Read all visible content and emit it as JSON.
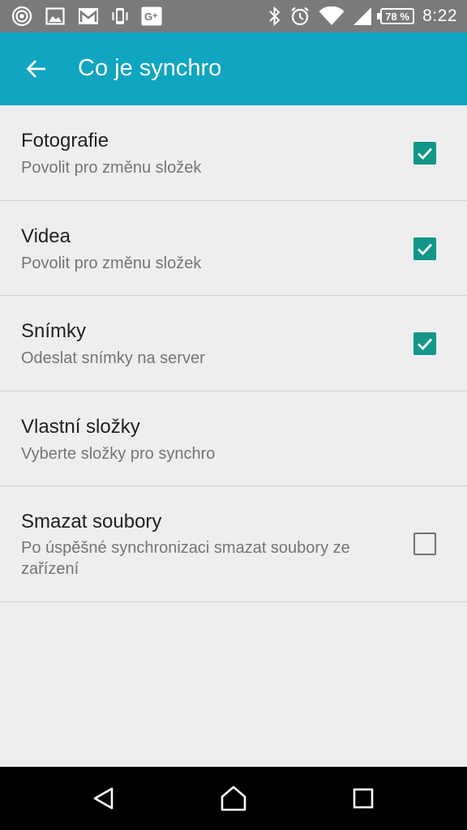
{
  "status_bar": {
    "left_icons": [
      "target-icon",
      "image-icon",
      "gmail-icon",
      "phone-vibrate-icon",
      "google-plus-icon"
    ],
    "right_icons": [
      "bluetooth-icon",
      "alarm-icon",
      "wifi-icon",
      "cell-signal-icon"
    ],
    "battery_text": "78 %",
    "time": "8:22"
  },
  "app_bar": {
    "title": "Co je synchro",
    "color": "#10a5c0"
  },
  "settings": [
    {
      "title": "Fotografie",
      "subtitle": "Povolit pro změnu složek",
      "checked": true
    },
    {
      "title": "Videa",
      "subtitle": "Povolit pro změnu složek",
      "checked": true
    },
    {
      "title": "Snímky",
      "subtitle": "Odeslat snímky na server",
      "checked": true
    },
    {
      "title": "Vlastní složky",
      "subtitle": "Vyberte složky pro synchro",
      "checked": null
    },
    {
      "title": "Smazat soubory",
      "subtitle": "Po úspěšné synchronizaci smazat soubory ze zařízení",
      "checked": false
    }
  ],
  "nav_bar": {
    "buttons": [
      "back-triangle-icon",
      "home-icon",
      "recents-square-icon"
    ]
  },
  "colors": {
    "accent": "#13968a",
    "background": "#eeeeee"
  }
}
